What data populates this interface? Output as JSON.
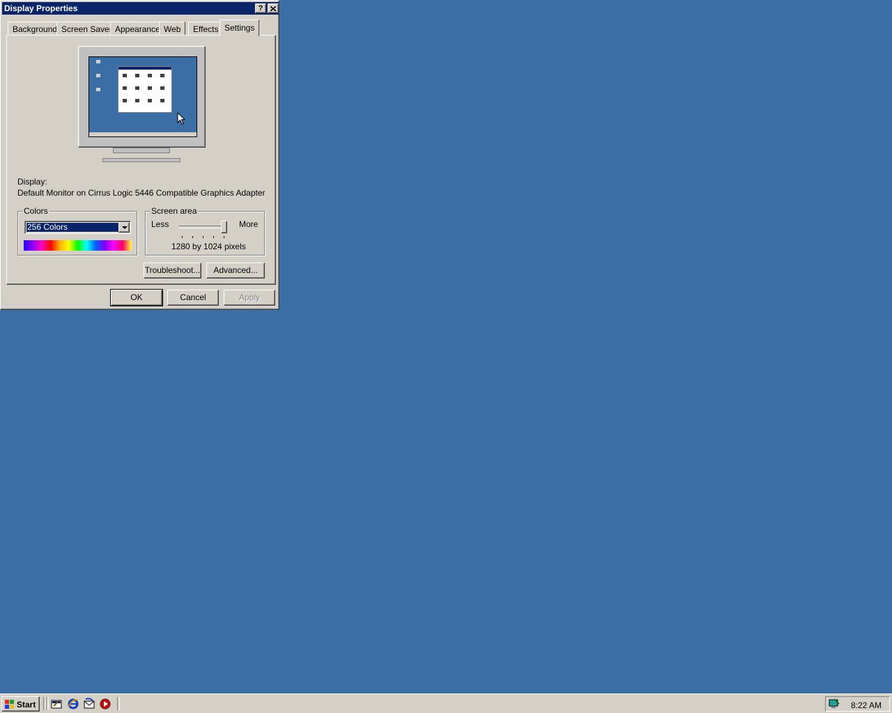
{
  "window": {
    "title": "Display Properties",
    "help_label": "?",
    "close_label": "✕"
  },
  "tabs": [
    {
      "label": "Background"
    },
    {
      "label": "Screen Saver"
    },
    {
      "label": "Appearance"
    },
    {
      "label": "Web"
    },
    {
      "label": "Effects"
    },
    {
      "label": "Settings",
      "active": true
    }
  ],
  "settings": {
    "display_label": "Display:",
    "display_value": "Default Monitor on Cirrus Logic 5446 Compatible Graphics Adapter",
    "colors": {
      "legend": "Colors",
      "selected": "256 Colors"
    },
    "screen_area": {
      "legend": "Screen area",
      "less_label": "Less",
      "more_label": "More",
      "resolution_text": "1280 by 1024 pixels",
      "slider_position_fraction": 1.0
    },
    "troubleshoot_label": "Troubleshoot...",
    "advanced_label": "Advanced..."
  },
  "dialog_buttons": {
    "ok": "OK",
    "cancel": "Cancel",
    "apply": "Apply",
    "apply_enabled": false
  },
  "taskbar": {
    "start_label": "Start",
    "quick_launch": [
      "show-desktop-icon",
      "internet-explorer-icon",
      "outlook-express-icon",
      "media-player-icon"
    ],
    "tray_icons": [
      "display-settings-icon"
    ],
    "clock": "8:22 AM"
  },
  "colors": {
    "desktop": "#3a6ea5",
    "titlebar": "#0a246a",
    "face": "#d4d0c8"
  }
}
